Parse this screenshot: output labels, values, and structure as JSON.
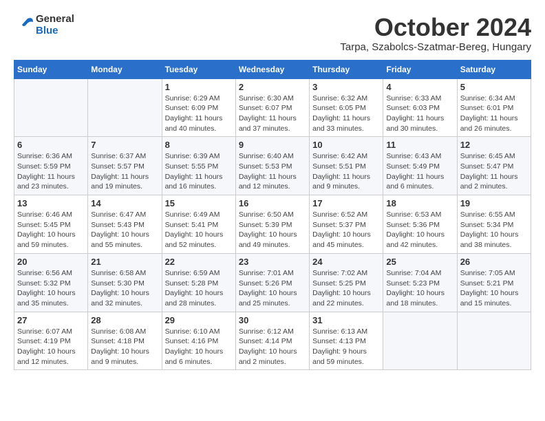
{
  "header": {
    "logo_line1": "General",
    "logo_line2": "Blue",
    "month_title": "October 2024",
    "subtitle": "Tarpa, Szabolcs-Szatmar-Bereg, Hungary"
  },
  "days_of_week": [
    "Sunday",
    "Monday",
    "Tuesday",
    "Wednesday",
    "Thursday",
    "Friday",
    "Saturday"
  ],
  "weeks": [
    [
      {
        "day": "",
        "info": ""
      },
      {
        "day": "",
        "info": ""
      },
      {
        "day": "1",
        "info": "Sunrise: 6:29 AM\nSunset: 6:09 PM\nDaylight: 11 hours and 40 minutes."
      },
      {
        "day": "2",
        "info": "Sunrise: 6:30 AM\nSunset: 6:07 PM\nDaylight: 11 hours and 37 minutes."
      },
      {
        "day": "3",
        "info": "Sunrise: 6:32 AM\nSunset: 6:05 PM\nDaylight: 11 hours and 33 minutes."
      },
      {
        "day": "4",
        "info": "Sunrise: 6:33 AM\nSunset: 6:03 PM\nDaylight: 11 hours and 30 minutes."
      },
      {
        "day": "5",
        "info": "Sunrise: 6:34 AM\nSunset: 6:01 PM\nDaylight: 11 hours and 26 minutes."
      }
    ],
    [
      {
        "day": "6",
        "info": "Sunrise: 6:36 AM\nSunset: 5:59 PM\nDaylight: 11 hours and 23 minutes."
      },
      {
        "day": "7",
        "info": "Sunrise: 6:37 AM\nSunset: 5:57 PM\nDaylight: 11 hours and 19 minutes."
      },
      {
        "day": "8",
        "info": "Sunrise: 6:39 AM\nSunset: 5:55 PM\nDaylight: 11 hours and 16 minutes."
      },
      {
        "day": "9",
        "info": "Sunrise: 6:40 AM\nSunset: 5:53 PM\nDaylight: 11 hours and 12 minutes."
      },
      {
        "day": "10",
        "info": "Sunrise: 6:42 AM\nSunset: 5:51 PM\nDaylight: 11 hours and 9 minutes."
      },
      {
        "day": "11",
        "info": "Sunrise: 6:43 AM\nSunset: 5:49 PM\nDaylight: 11 hours and 6 minutes."
      },
      {
        "day": "12",
        "info": "Sunrise: 6:45 AM\nSunset: 5:47 PM\nDaylight: 11 hours and 2 minutes."
      }
    ],
    [
      {
        "day": "13",
        "info": "Sunrise: 6:46 AM\nSunset: 5:45 PM\nDaylight: 10 hours and 59 minutes."
      },
      {
        "day": "14",
        "info": "Sunrise: 6:47 AM\nSunset: 5:43 PM\nDaylight: 10 hours and 55 minutes."
      },
      {
        "day": "15",
        "info": "Sunrise: 6:49 AM\nSunset: 5:41 PM\nDaylight: 10 hours and 52 minutes."
      },
      {
        "day": "16",
        "info": "Sunrise: 6:50 AM\nSunset: 5:39 PM\nDaylight: 10 hours and 49 minutes."
      },
      {
        "day": "17",
        "info": "Sunrise: 6:52 AM\nSunset: 5:37 PM\nDaylight: 10 hours and 45 minutes."
      },
      {
        "day": "18",
        "info": "Sunrise: 6:53 AM\nSunset: 5:36 PM\nDaylight: 10 hours and 42 minutes."
      },
      {
        "day": "19",
        "info": "Sunrise: 6:55 AM\nSunset: 5:34 PM\nDaylight: 10 hours and 38 minutes."
      }
    ],
    [
      {
        "day": "20",
        "info": "Sunrise: 6:56 AM\nSunset: 5:32 PM\nDaylight: 10 hours and 35 minutes."
      },
      {
        "day": "21",
        "info": "Sunrise: 6:58 AM\nSunset: 5:30 PM\nDaylight: 10 hours and 32 minutes."
      },
      {
        "day": "22",
        "info": "Sunrise: 6:59 AM\nSunset: 5:28 PM\nDaylight: 10 hours and 28 minutes."
      },
      {
        "day": "23",
        "info": "Sunrise: 7:01 AM\nSunset: 5:26 PM\nDaylight: 10 hours and 25 minutes."
      },
      {
        "day": "24",
        "info": "Sunrise: 7:02 AM\nSunset: 5:25 PM\nDaylight: 10 hours and 22 minutes."
      },
      {
        "day": "25",
        "info": "Sunrise: 7:04 AM\nSunset: 5:23 PM\nDaylight: 10 hours and 18 minutes."
      },
      {
        "day": "26",
        "info": "Sunrise: 7:05 AM\nSunset: 5:21 PM\nDaylight: 10 hours and 15 minutes."
      }
    ],
    [
      {
        "day": "27",
        "info": "Sunrise: 6:07 AM\nSunset: 4:19 PM\nDaylight: 10 hours and 12 minutes."
      },
      {
        "day": "28",
        "info": "Sunrise: 6:08 AM\nSunset: 4:18 PM\nDaylight: 10 hours and 9 minutes."
      },
      {
        "day": "29",
        "info": "Sunrise: 6:10 AM\nSunset: 4:16 PM\nDaylight: 10 hours and 6 minutes."
      },
      {
        "day": "30",
        "info": "Sunrise: 6:12 AM\nSunset: 4:14 PM\nDaylight: 10 hours and 2 minutes."
      },
      {
        "day": "31",
        "info": "Sunrise: 6:13 AM\nSunset: 4:13 PM\nDaylight: 9 hours and 59 minutes."
      },
      {
        "day": "",
        "info": ""
      },
      {
        "day": "",
        "info": ""
      }
    ]
  ]
}
